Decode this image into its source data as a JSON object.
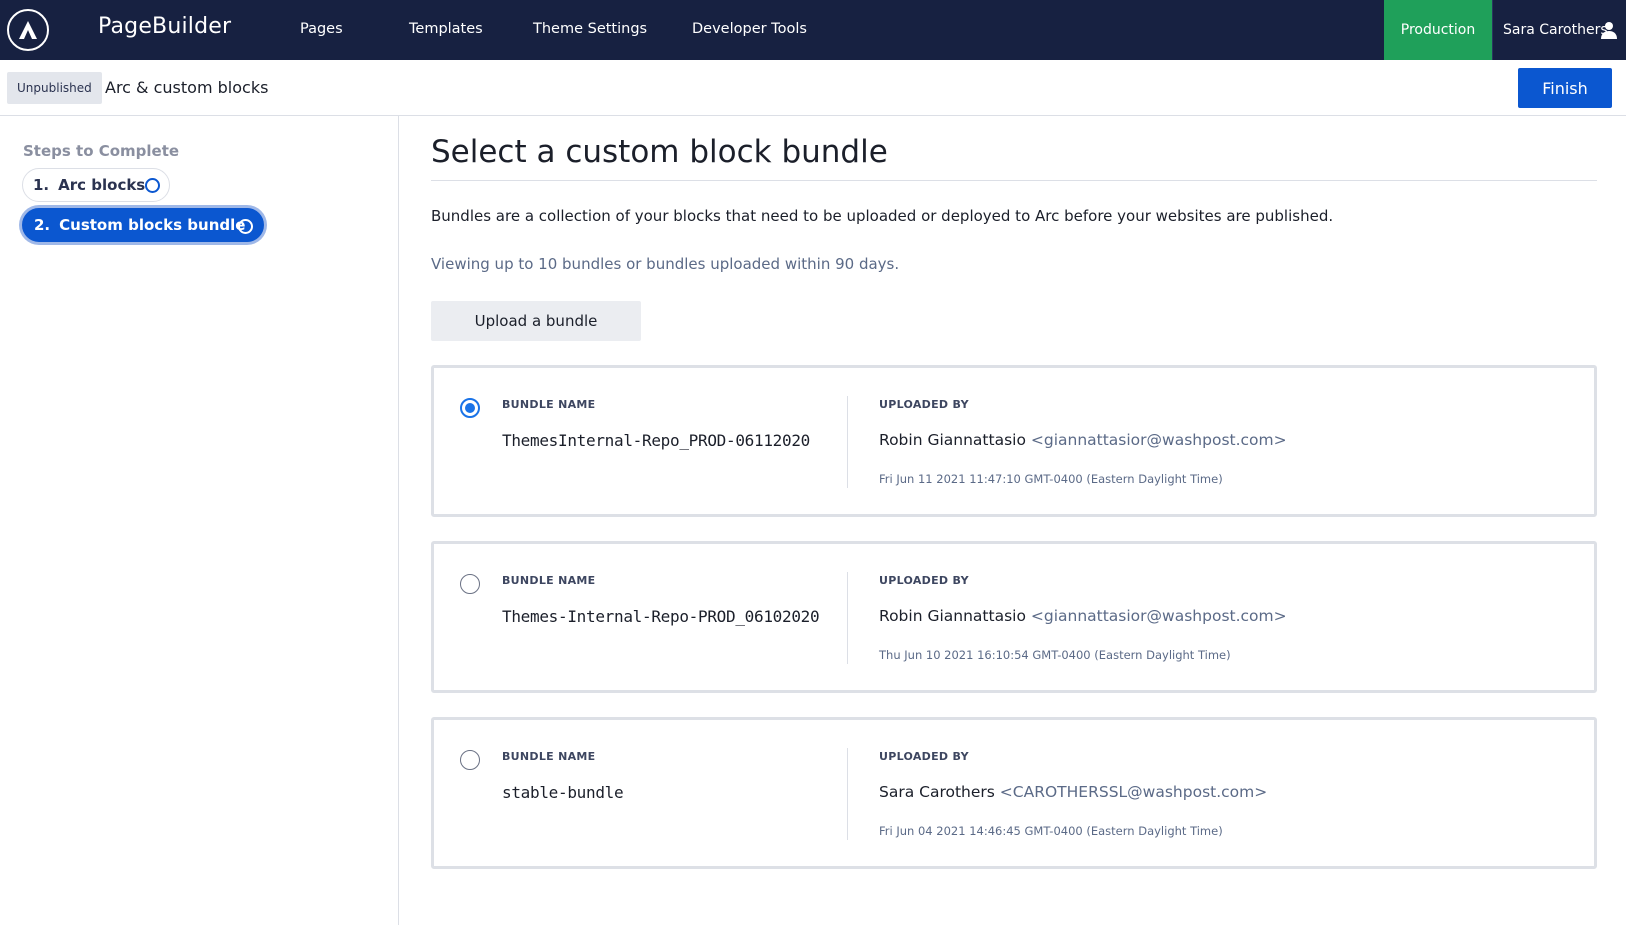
{
  "topnav": {
    "app_title": "PageBuilder",
    "items": [
      {
        "label": "Pages"
      },
      {
        "label": "Templates"
      },
      {
        "label": "Theme Settings"
      },
      {
        "label": "Developer Tools"
      }
    ],
    "environment": "Production",
    "user_name": "Sara Carothers"
  },
  "subheader": {
    "status": "Unpublished",
    "page_name": "Arc & custom blocks",
    "finish_label": "Finish"
  },
  "sidebar": {
    "title": "Steps to Complete",
    "steps": [
      {
        "number": "1.",
        "label": "Arc blocks"
      },
      {
        "number": "2.",
        "label": "Custom blocks bundle"
      }
    ]
  },
  "main": {
    "title": "Select a custom block bundle",
    "description": "Bundles are a collection of your blocks that need to be uploaded or deployed to Arc before your websites are published.",
    "subdescription": "Viewing up to 10 bundles or bundles uploaded within 90 days.",
    "upload_label": "Upload a bundle",
    "bundle_name_label": "BUNDLE NAME",
    "uploaded_by_label": "UPLOADED BY",
    "bundles": [
      {
        "name": "ThemesInternal-Repo_PROD-06112020",
        "uploader": "Robin Giannattasio",
        "email": "<giannattasior@washpost.com>",
        "uploaded_at": "Fri Jun 11 2021 11:47:10 GMT-0400 (Eastern Daylight Time)",
        "selected": true
      },
      {
        "name": "Themes-Internal-Repo-PROD_06102020",
        "uploader": "Robin Giannattasio",
        "email": "<giannattasior@washpost.com>",
        "uploaded_at": "Thu Jun 10 2021 16:10:54 GMT-0400 (Eastern Daylight Time)",
        "selected": false
      },
      {
        "name": "stable-bundle",
        "uploader": "Sara Carothers",
        "email": "<CAROTHERSSL@washpost.com>",
        "uploaded_at": "Fri Jun 04 2021 14:46:45 GMT-0400 (Eastern Daylight Time)",
        "selected": false
      }
    ]
  },
  "colors": {
    "nav_bg": "#172141",
    "environment_badge": "#1fa05a",
    "primary": "#0b57d0"
  }
}
